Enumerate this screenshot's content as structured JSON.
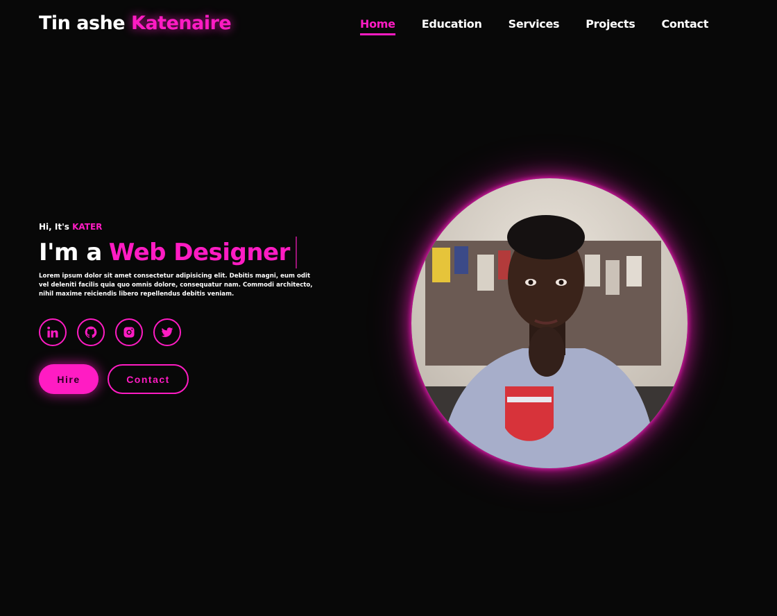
{
  "brand": {
    "first": "Tin ashe",
    "last": "Katenaire"
  },
  "nav": [
    {
      "label": "Home",
      "active": true
    },
    {
      "label": "Education",
      "active": false
    },
    {
      "label": "Services",
      "active": false
    },
    {
      "label": "Projects",
      "active": false
    },
    {
      "label": "Contact",
      "active": false
    }
  ],
  "hero": {
    "greeting": "Hi, It's",
    "nickname": "KATER",
    "title_prefix": "I'm a",
    "role": "Web Designer",
    "description": "Lorem ipsum dolor sit amet consectetur adipisicing elit. Debitis magni, eum odit vel deleniti facilis quia quo omnis dolore, consequatur nam. Commodi architecto, nihil maxime reiciendis libero repellendus debitis veniam."
  },
  "socials": [
    {
      "icon": "linkedin-icon"
    },
    {
      "icon": "github-icon"
    },
    {
      "icon": "instagram-icon"
    },
    {
      "icon": "twitter-icon"
    }
  ],
  "buttons": {
    "hire": "Hire",
    "contact": "Contact"
  },
  "colors": {
    "accent": "#ff1cc3",
    "background": "#080808",
    "text": "#ffffff"
  }
}
